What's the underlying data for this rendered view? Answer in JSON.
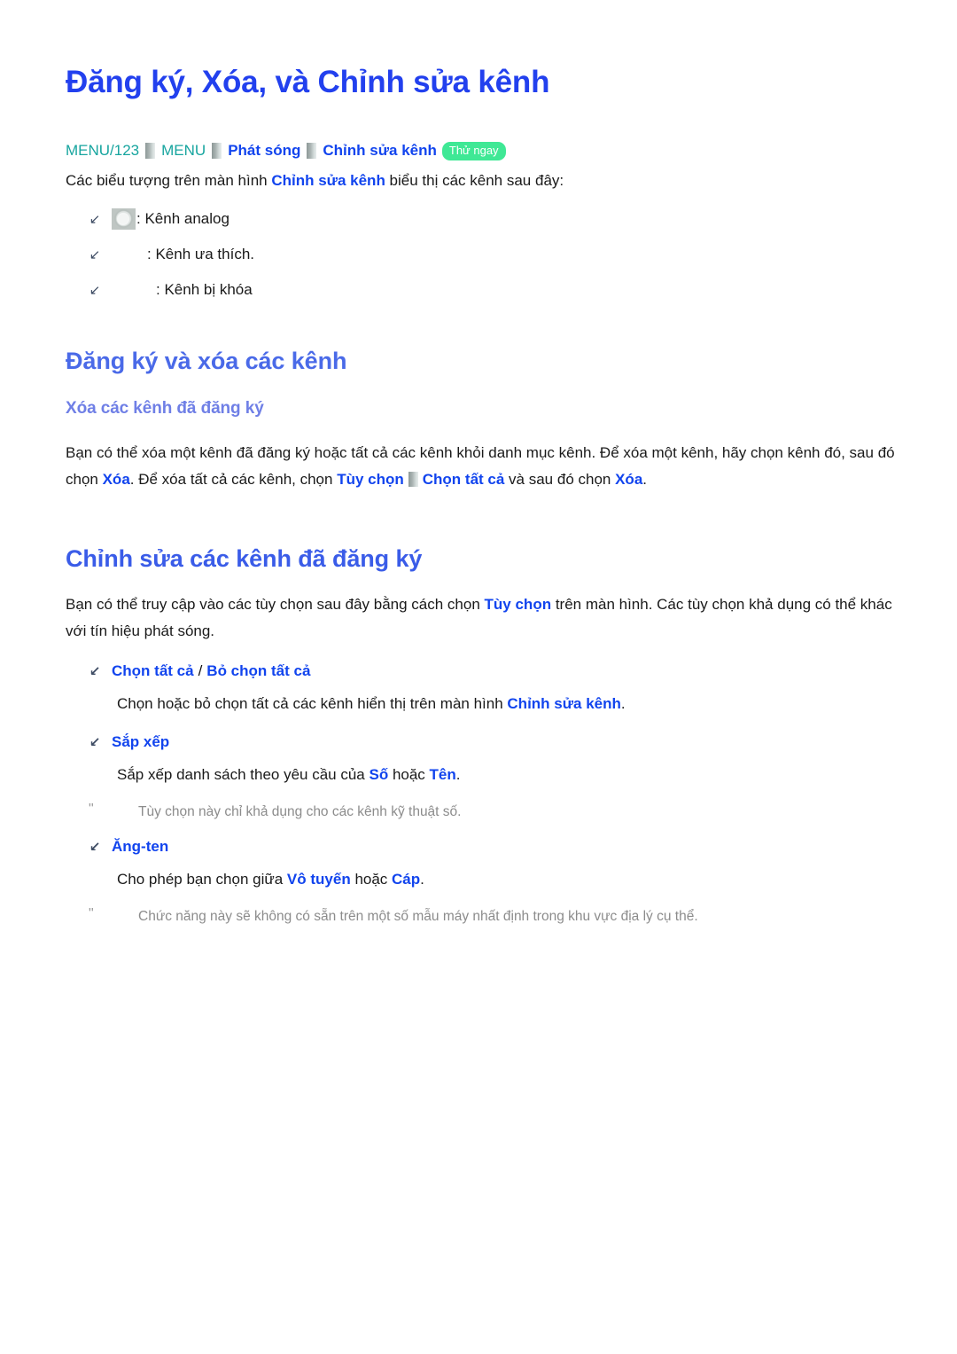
{
  "document": {
    "title": "Đăng ký, Xóa, và Chỉnh sửa kênh"
  },
  "breadcrumb": {
    "name": "breadcrumb",
    "menu_code": "MENU/123",
    "menu_label": "MENU",
    "item_broadcast": "Phát sóng",
    "item_edit_channel": "Chỉnh sửa kênh",
    "try_now_badge": "Thử ngay"
  },
  "intro": {
    "text_before": "Các biểu tượng trên màn hình ",
    "keyword": "Chỉnh sửa kênh",
    "text_after": " biểu thị các kênh sau đây:"
  },
  "legend": [
    {
      "icon": "analog-channel-icon",
      "label": ": Kênh analog"
    },
    {
      "icon": "favorite-channel-icon",
      "label": ": Kênh ưa thích."
    },
    {
      "icon": "locked-channel-icon",
      "label": ": Kênh bị khóa"
    }
  ],
  "section_subscribe_delete": {
    "heading": "Đăng ký và xóa các kênh",
    "sub_heading": "Xóa các kênh đã đăng ký",
    "paragraph": {
      "p1": "Bạn có thể xóa một kênh đã đăng ký hoặc tất cả các kênh khỏi danh mục kênh. Để xóa một kênh, hãy chọn kênh đó, sau đó chọn ",
      "kw1": "Xóa",
      "p2": ". Để xóa tất cả các kênh, chọn ",
      "kw2": "Tùy chọn",
      "kw3": "Chọn tất cả",
      "p3": " và sau đó chọn ",
      "kw4": "Xóa",
      "p4": "."
    }
  },
  "section_edit_subscribed": {
    "heading": "Chỉnh sửa các kênh đã đăng ký",
    "intro": {
      "p1": "Bạn có thể truy cập vào các tùy chọn sau đây bằng cách chọn ",
      "kw1": "Tùy chọn",
      "p2": " trên màn hình. Các tùy chọn khả dụng có thể khác với tín hiệu phát sóng."
    },
    "options": [
      {
        "name": "Chọn tất cả",
        "separator": "/",
        "name_alt": "Bỏ chọn tất cả",
        "body_before": "Chọn hoặc bỏ chọn tất cả các kênh hiển thị trên màn hình ",
        "body_keyword": "Chỉnh sửa kênh",
        "body_after": "."
      },
      {
        "name": "Sắp xếp",
        "body_before": "Sắp xếp danh sách theo yêu cầu của ",
        "body_keyword": "Số",
        "body_mid": " hoặc ",
        "body_keyword2": "Tên",
        "body_after": ".",
        "note": "Tùy chọn này chỉ khả dụng cho các kênh kỹ thuật số."
      },
      {
        "name": "Ăng-ten",
        "body_before": "Cho phép bạn chọn giữa ",
        "body_keyword": "Vô tuyến",
        "body_mid": " hoặc ",
        "body_keyword2": "Cáp",
        "body_after": ".",
        "note": "Chức năng này sẽ không có sẵn trên một số mẫu máy nhất định trong khu vực địa lý cụ thể."
      }
    ]
  },
  "colors": {
    "title_blue": "#2240ee",
    "section_blue": "#4a6ae8",
    "sub_blue": "#6f7fe6",
    "keyword_blue": "#1144ee",
    "breadcrumb_teal": "#17a59f",
    "badge_green": "#3fe895",
    "note_gray": "#8c8c8c"
  },
  "glyphs": {
    "arrow_bullet": "↙",
    "note_mark": "\""
  }
}
